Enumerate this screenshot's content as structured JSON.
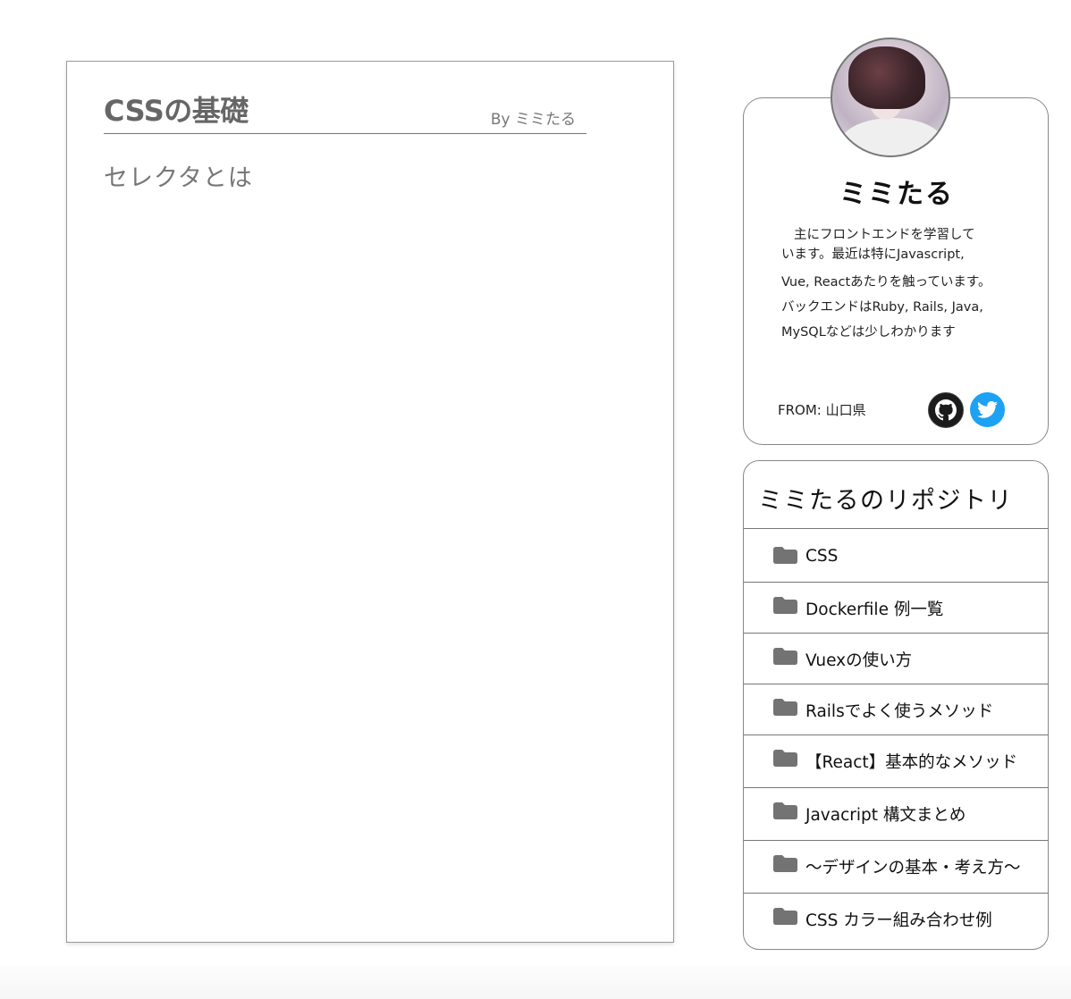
{
  "article": {
    "title": "CSSの基礎",
    "author": "By ミミたる",
    "heading": "セレクタとは"
  },
  "profile": {
    "name": "ミミたる",
    "bio_lines": [
      "主にフロントエンドを学習して",
      "います。最近は特にJavascript,",
      "Vue, Reactあたりを触っています。",
      "バックエンドはRuby, Rails, Java,",
      "MySQLなどは少しわかります"
    ],
    "from": "FROM: 山口県",
    "social": [
      "github-icon",
      "twitter-icon"
    ],
    "colors": {
      "twitter": "#1da1f2",
      "github": "#1b1b1b"
    }
  },
  "repos": {
    "title": "ミミたるのリポジトリ",
    "items": [
      "CSS",
      "Dockerfile 例一覧",
      "Vuexの使い方",
      "Railsでよく使うメソッド",
      "【React】基本的なメソッド",
      "Javacript 構文まとめ",
      "〜デザインの基本・考え方〜",
      "CSS カラー組み合わせ例"
    ],
    "item_icon": "folder-icon"
  }
}
